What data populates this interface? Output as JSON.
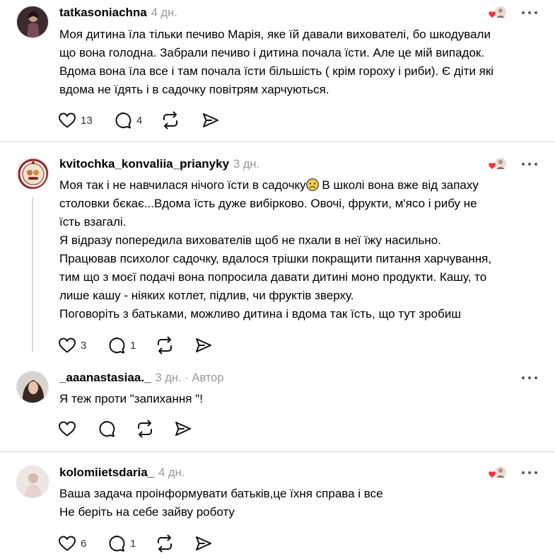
{
  "comments": [
    {
      "username": "tatkasoniachna",
      "time": "4 дн.",
      "author_label": "",
      "lines": [
        "Моя дитина їла тільки печиво Марія, яке їй давали вихователі, бо шкодували",
        "що вона голодна. Забрали печиво і дитина почала їсти. Але це мій випадок.",
        "Вдома вона їла все і там почала їсти більшість ( крім гороху і риби). Є діти які",
        "вдома не їдять і в садочку повітрям харчуються."
      ],
      "likes": "13",
      "replies": "4",
      "liked_by_author": true
    },
    {
      "username": "kvitochka_konvaliia_prianyky",
      "time": "3 дн.",
      "author_label": "",
      "line1_before_emoji": "Моя так і не навчилася нічого їсти в садочку",
      "line1_after_emoji": " В школі вона вже від запаху",
      "lines": [
        "столовки бєкає...Вдома їсть дуже вибірково. Овочі, фрукти, м'ясо і рибу не",
        "їсть взагалі.",
        "Я відразу попередила вихователів щоб не пхали в неї їжу насильно.",
        "Працював психолог садочку, вдалося трішки покращити питання харчування,",
        "тим що з моєї подачі вона попросила давати дитині моно продукти. Кашу, то",
        "лише кашу - ніяких котлет, підлив, чи фруктів зверху.",
        "Поговоріть з батьками, можливо дитина і вдома так їсть, що тут зробиш"
      ],
      "likes": "3",
      "replies": "1",
      "liked_by_author": true
    },
    {
      "username": "_aaanastasiaa._",
      "time": "3 дн.",
      "author_label": "· Автор",
      "lines": [
        "Я теж проти \"запихання \"!"
      ],
      "likes": "",
      "replies": "",
      "liked_by_author": false
    },
    {
      "username": "kolomiietsdaria_",
      "time": "4 дн.",
      "author_label": "",
      "lines": [
        "Ваша задача проінформувати батьків,це їхня справа і все",
        "Не беріть на себе зайву роботу"
      ],
      "likes": "6",
      "replies": "1",
      "liked_by_author": true
    }
  ],
  "icons": {
    "like": "heart-outline-icon",
    "reply": "speech-bubble-icon",
    "repost": "repost-arrows-icon",
    "share": "send-paper-plane-icon",
    "more": "more-dots-icon",
    "liked_by_author": "red-heart-with-author-avatar-icon"
  },
  "colors": {
    "text": "#000000",
    "muted": "#999999",
    "liked_heart": "#ff3040",
    "divider": "#dcdcdc"
  }
}
